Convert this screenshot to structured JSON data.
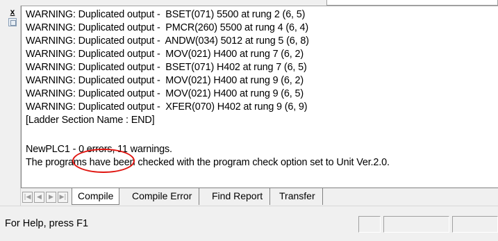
{
  "output_window": {
    "close_glyph": "x",
    "lines": [
      "WARNING: Duplicated output -  BSET(071) 5500 at rung 2 (6, 5)",
      "WARNING: Duplicated output -  PMCR(260) 5500 at rung 4 (6, 4)",
      "WARNING: Duplicated output -  ANDW(034) 5012 at rung 5 (6, 8)",
      "WARNING: Duplicated output -  MOV(021) H400 at rung 7 (6, 2)",
      "WARNING: Duplicated output -  BSET(071) H402 at rung 7 (6, 5)",
      "WARNING: Duplicated output -  MOV(021) H400 at rung 9 (6, 2)",
      "WARNING: Duplicated output -  MOV(021) H400 at rung 9 (6, 5)",
      "WARNING: Duplicated output -  XFER(070) H402 at rung 9 (6, 9)",
      "[Ladder Section Name : END]",
      "",
      "NewPLC1 - 0 errors, 11 warnings.",
      "The programs have been checked with the program check option set to Unit Ver.2.0."
    ]
  },
  "tabs": {
    "nav_buttons": [
      "first",
      "previous",
      "next",
      "last"
    ],
    "items": [
      "Compile",
      "Compile Error",
      "Find Report",
      "Transfer"
    ],
    "active": "Compile"
  },
  "status_bar": {
    "help_text": "For Help, press F1"
  },
  "annotation": {
    "color": "#e0140f"
  }
}
